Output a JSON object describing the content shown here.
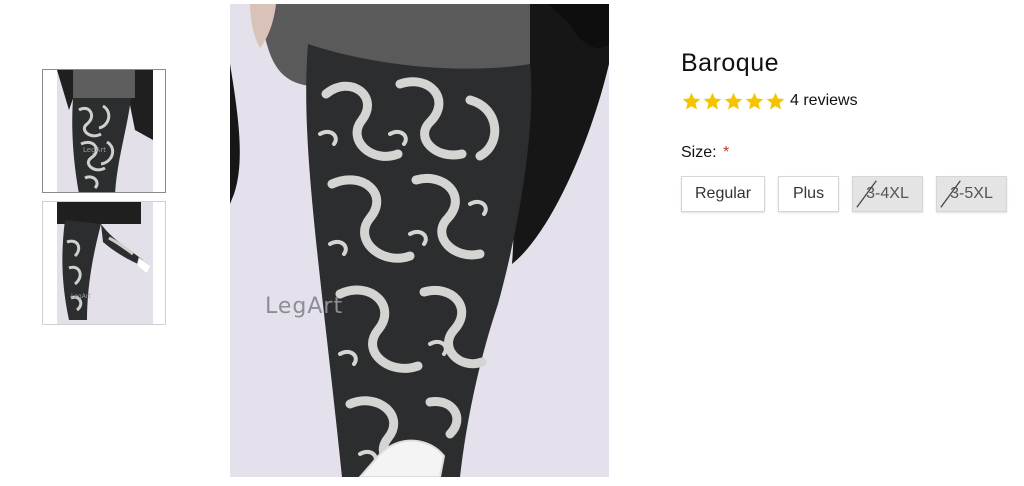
{
  "product": {
    "title": "Baroque",
    "rating_stars": 5,
    "reviews_text": "4 reviews",
    "size_label": "Size:",
    "required_mark": "*",
    "sizes": [
      {
        "label": "Regular",
        "available": true
      },
      {
        "label": "Plus",
        "available": true
      },
      {
        "label": "3-4XL",
        "available": false
      },
      {
        "label": "3-5XL",
        "available": false
      }
    ]
  },
  "gallery": {
    "watermark": "LegArt",
    "thumb_watermark": "LegArt"
  },
  "colors": {
    "star": "#f5c400",
    "required": "#c0392b",
    "legging_dark": "#2c2d2f",
    "pattern_light": "#d4d4d2"
  }
}
